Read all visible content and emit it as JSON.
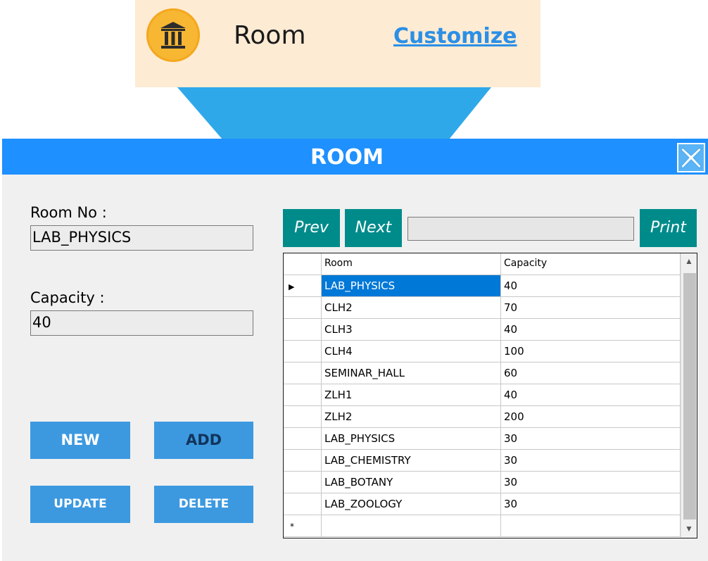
{
  "tile": {
    "title": "Room",
    "link": "Customize",
    "icon": "institution-icon"
  },
  "window": {
    "title": "ROOM",
    "close_label": "X"
  },
  "form": {
    "room_no_label": "Room No :",
    "room_no_value": "LAB_PHYSICS",
    "capacity_label": "Capacity :",
    "capacity_value": "40"
  },
  "buttons": {
    "new": "NEW",
    "add": "ADD",
    "update": "UPDATE",
    "delete": "DELETE"
  },
  "nav": {
    "prev": "Prev",
    "next": "Next",
    "print": "Print",
    "search_value": ""
  },
  "grid": {
    "columns": [
      "Room",
      "Capacity"
    ],
    "rows": [
      {
        "room": "LAB_PHYSICS",
        "capacity": "40"
      },
      {
        "room": "CLH2",
        "capacity": "70"
      },
      {
        "room": "CLH3",
        "capacity": "40"
      },
      {
        "room": "CLH4",
        "capacity": "100"
      },
      {
        "room": "SEMINAR_HALL",
        "capacity": "60"
      },
      {
        "room": "ZLH1",
        "capacity": "40"
      },
      {
        "room": "ZLH2",
        "capacity": "200"
      },
      {
        "room": "LAB_PHYSICS",
        "capacity": "30"
      },
      {
        "room": "LAB_CHEMISTRY",
        "capacity": "30"
      },
      {
        "room": "LAB_BOTANY",
        "capacity": "30"
      },
      {
        "room": "LAB_ZOOLOGY",
        "capacity": "30"
      }
    ],
    "current_row_marker": "▶",
    "new_row_marker": "*"
  },
  "colors": {
    "accent": "#1e90ff",
    "button": "#3c99e0",
    "nav": "#008b8b",
    "tile_bg": "#fdebd3",
    "selection": "#0078d7"
  }
}
